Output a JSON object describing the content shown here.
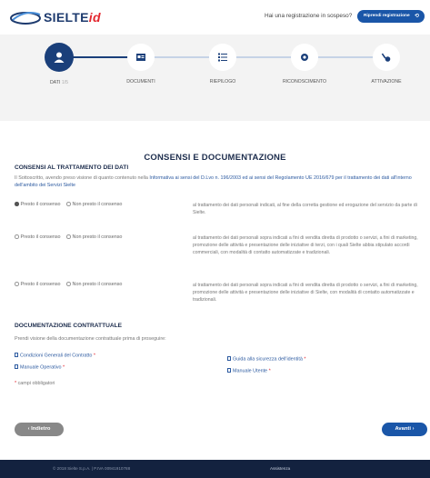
{
  "header": {
    "logo_text": "SIELTE",
    "logo_suffix": "id",
    "pending_question": "Hai una registrazione in sospeso?",
    "resume_label": "Riprendi registrazione"
  },
  "steps": [
    {
      "label": "DATI",
      "progress": "1/5",
      "icon": "user-icon",
      "active": true
    },
    {
      "label": "DOCUMENTI",
      "icon": "id-card-icon",
      "active": false
    },
    {
      "label": "RIEPILOGO",
      "icon": "list-icon",
      "active": false
    },
    {
      "label": "RICONOSCIMENTO",
      "icon": "webcam-icon",
      "active": false
    },
    {
      "label": "ATTIVAZIONE",
      "icon": "key-icon",
      "active": false
    }
  ],
  "page_title": "CONSENSI E DOCUMENTAZIONE",
  "consents": {
    "title": "CONSENSI AL TRATTAMENTO DEI DATI",
    "intro_before": "Il Sottoscritto, avendo preso visione di quanto contenuto nella ",
    "intro_link": "Informativa ai sensi del D.Lvo n. 196/2003 ed ai sensi del Regolamento UE 2016/679 per il trattamento dei dati all'interno dell'ambito dei Servizi Sielte",
    "give_label": "Presto il consenso",
    "deny_label": "Non presto il consenso",
    "rows": [
      {
        "selected": "give",
        "text": "al trattamento dei dati personali indicati, al fine della corretta gestione ed erogazione del servizio da parte di Sielte."
      },
      {
        "selected": "none",
        "text": "al trattamento dei dati personali sopra indicati a fini di vendita diretta di prodotto o servizi, a fini di marketing, promozione delle attività e presentazione delle iniziative di terzi, con i quali Sielte abbia stipulato accordi commerciali, con modalità di contatto automatizzate e tradizionali."
      },
      {
        "selected": "none",
        "text": "al trattamento dei dati personali sopra indicati a fini di vendita diretta di prodotto o servizi, a fini di marketing, promozione delle attività e presentazione delle iniziative di Sielte, con modalità di contatto automatizzate e tradizionali."
      }
    ]
  },
  "documents": {
    "title": "DOCUMENTAZIONE CONTRATTUALE",
    "intro": "Prendi visione della documentazione contrattuale prima di proseguire:",
    "links": [
      {
        "label": "Condizioni Generali del Contratto",
        "required": "*"
      },
      {
        "label": "Guida alla sicurezza dell'identità",
        "required": "*"
      },
      {
        "label": "Manuale Operativo",
        "required": "*"
      },
      {
        "label": "Manuale Utente",
        "required": "*"
      }
    ],
    "required_note": "campi obbligatori",
    "required_mark": "*"
  },
  "nav": {
    "back_label": "Indietro",
    "next_label": "Avanti"
  },
  "footer": {
    "copyright": "© 2018 Sielte S.p.A. | P.IVA 00941910788",
    "assistance": "Assistenza"
  },
  "colors": {
    "primary": "#1a56a8",
    "navy": "#1a3f7a",
    "footer_bg": "#13223f",
    "required": "#e3262e"
  }
}
